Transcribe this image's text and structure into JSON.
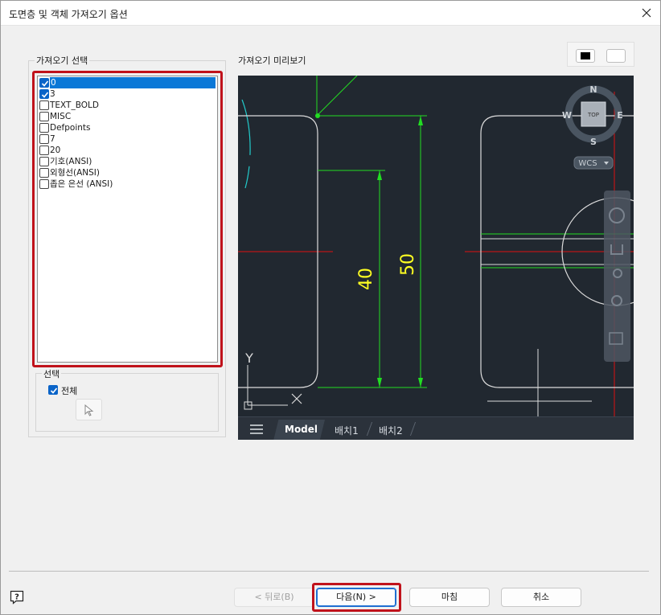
{
  "window": {
    "title": "도면층 및 객체 가져오기 옵션"
  },
  "import_selection": {
    "legend": "가져오기 선택",
    "layers": [
      {
        "name": "0",
        "checked": true,
        "selected": true
      },
      {
        "name": "3",
        "checked": true,
        "selected": false
      },
      {
        "name": "TEXT_BOLD",
        "checked": false,
        "selected": false
      },
      {
        "name": "MISC",
        "checked": false,
        "selected": false
      },
      {
        "name": "Defpoints",
        "checked": false,
        "selected": false
      },
      {
        "name": "7",
        "checked": false,
        "selected": false
      },
      {
        "name": "20",
        "checked": false,
        "selected": false
      },
      {
        "name": "기호(ANSI)",
        "checked": false,
        "selected": false
      },
      {
        "name": "외형선(ANSI)",
        "checked": false,
        "selected": false
      },
      {
        "name": "좁은 은선 (ANSI)",
        "checked": false,
        "selected": false
      }
    ],
    "selection": {
      "legend": "선택",
      "all_label": "전체",
      "all_checked": true
    }
  },
  "preview": {
    "label": "가져오기 미리보기",
    "background_options": [
      "black",
      "white"
    ],
    "viewcube": {
      "north": "N",
      "south": "S",
      "east": "E",
      "west": "W",
      "face": "TOP",
      "ucs": "WCS"
    },
    "dimensions": {
      "inner": "40",
      "outer": "50"
    },
    "axis_label": "Y",
    "tabs": {
      "model": "Model",
      "layout1": "배치1",
      "layout2": "배치2"
    }
  },
  "footer": {
    "back": "< 뒤로(B)",
    "next": "다음(N) >",
    "finish": "마침",
    "cancel": "취소"
  },
  "colors": {
    "highlight": "#c0121b",
    "checkbox": "#0a64c8",
    "selection": "#0a78d7",
    "dimension_line": "#22dd22",
    "dimension_text": "#ffff22",
    "axis_red": "#dd1111",
    "arc_cyan": "#22cccc",
    "preview_bg": "#212830"
  }
}
